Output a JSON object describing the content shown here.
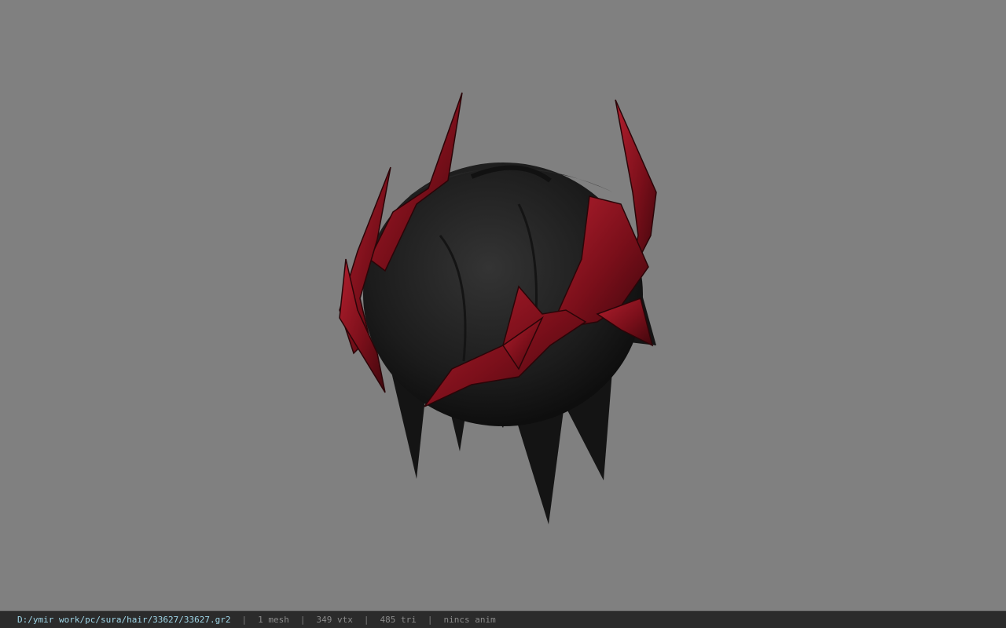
{
  "viewer": {
    "model_icon": "hair-mesh-model",
    "colors": {
      "background": "#808080",
      "hair": "#1e1e1e",
      "crown": "#7a0f1a",
      "crown_highlight": "#b21f2e"
    }
  },
  "status": {
    "file_path": "D:/ymir work/pc/sura/hair/33627/33627.gr2",
    "separator": "|",
    "mesh_count": "1 mesh",
    "vertex_count": "349 vtx",
    "triangle_count": "485 tri",
    "anim": "nincs anim"
  }
}
